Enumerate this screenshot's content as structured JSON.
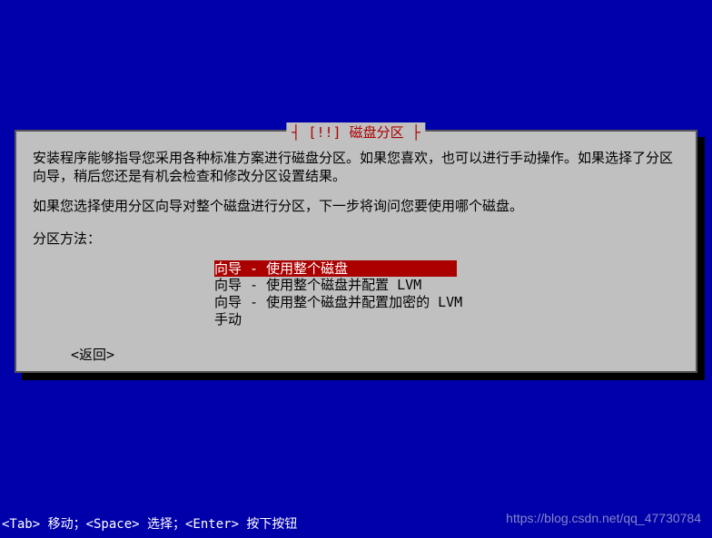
{
  "dialog": {
    "title": "┤ [!!] 磁盘分区 ├",
    "paragraph1": "安装程序能够指导您采用各种标准方案进行磁盘分区。如果您喜欢，也可以进行手动操作。如果选择了分区向导，稍后您还是有机会检查和修改分区设置结果。",
    "paragraph2": "如果您选择使用分区向导对整个磁盘进行分区，下一步将询问您要使用哪个磁盘。",
    "method_label": "分区方法：",
    "options": [
      "向导 - 使用整个磁盘",
      "向导 - 使用整个磁盘并配置 LVM",
      "向导 - 使用整个磁盘并配置加密的 LVM",
      "手动"
    ],
    "selected_index": 0,
    "back": "<返回>"
  },
  "footer_hint": "<Tab> 移动；<Space> 选择；<Enter> 按下按钮",
  "watermark": "https://blog.csdn.net/qq_47730784"
}
